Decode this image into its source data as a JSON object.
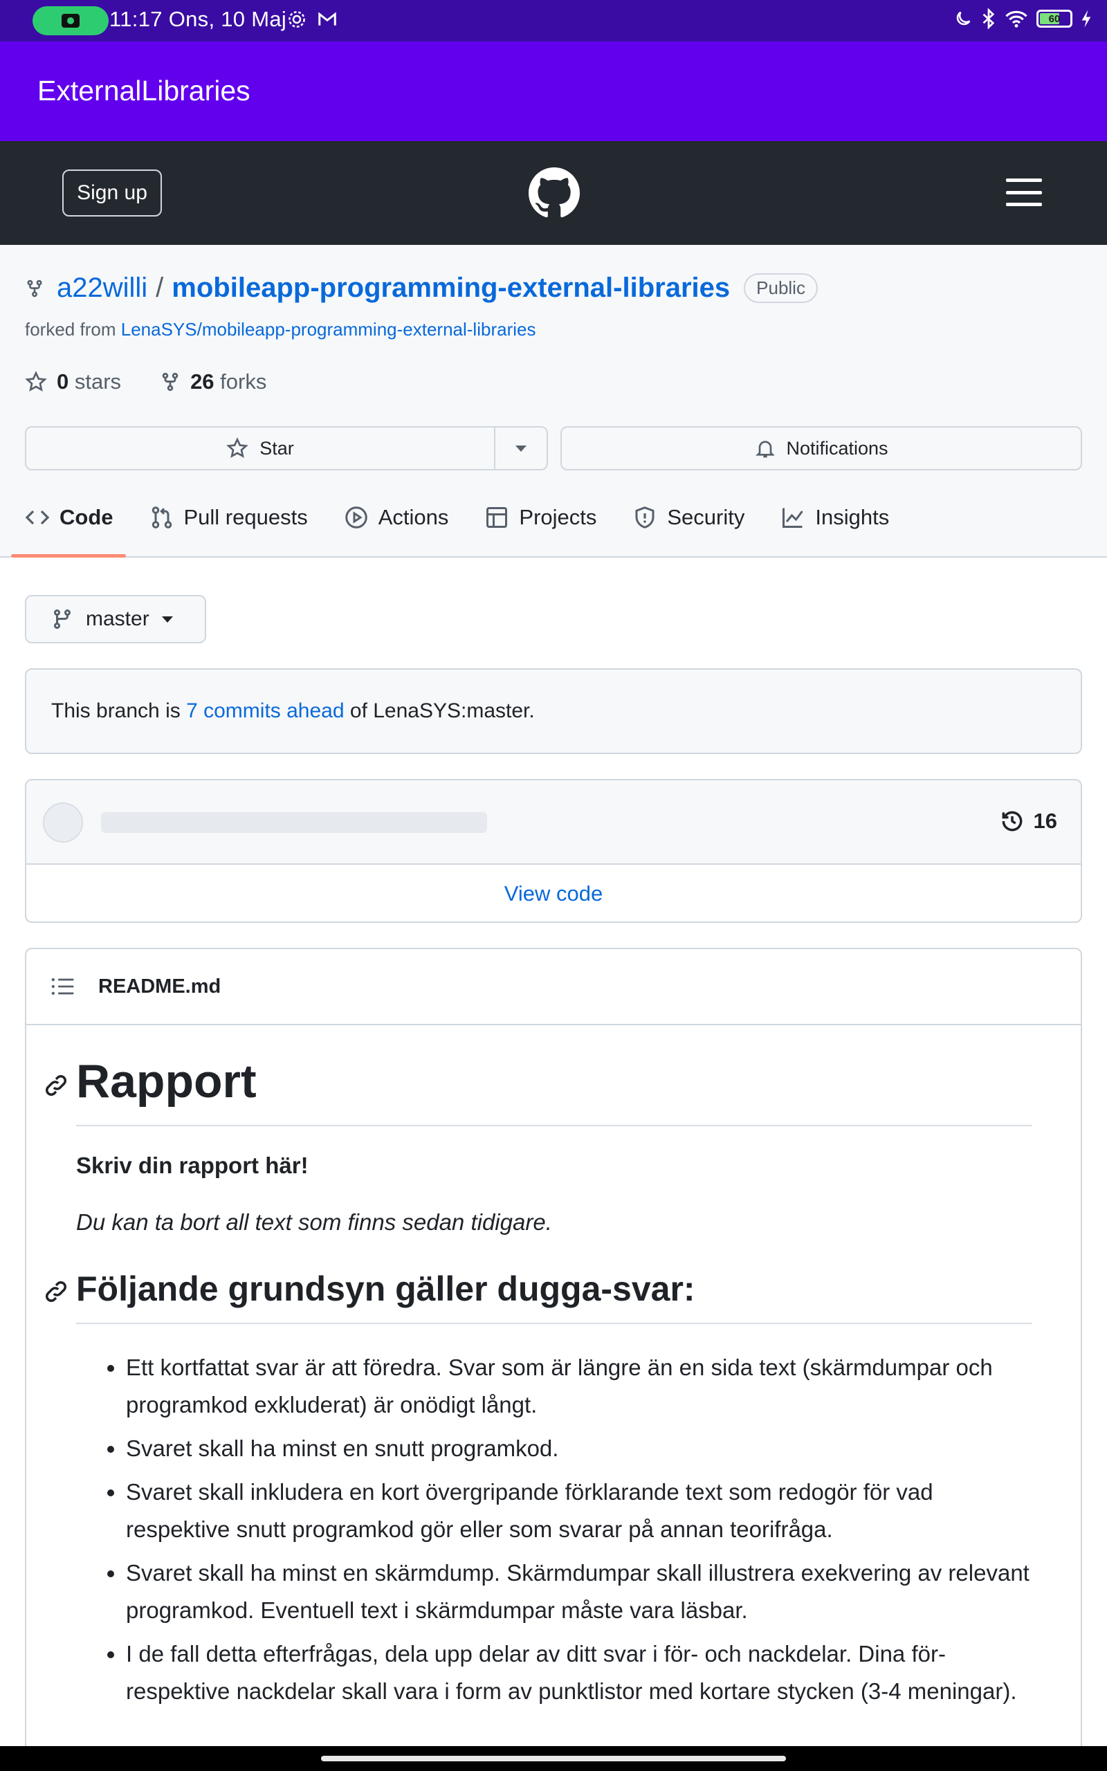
{
  "status_bar": {
    "time_date": "11:17 Ons, 10 Maj",
    "battery_level": "60"
  },
  "app_bar": {
    "title": "ExternalLibraries"
  },
  "github_header": {
    "signup_label": "Sign up"
  },
  "repo": {
    "owner": "a22willi",
    "separator": "/",
    "name": "mobileapp-programming-external-libraries",
    "visibility": "Public",
    "forked_prefix": "forked from",
    "forked_source": "LenaSYS/mobileapp-programming-external-libraries",
    "stars_count": "0",
    "stars_label": "stars",
    "forks_count": "26",
    "forks_label": "forks",
    "star_button": "Star",
    "notifications_button": "Notifications"
  },
  "tabs": [
    {
      "label": "Code",
      "icon": "code-icon",
      "active": true
    },
    {
      "label": "Pull requests",
      "icon": "pull-request-icon"
    },
    {
      "label": "Actions",
      "icon": "play-icon"
    },
    {
      "label": "Projects",
      "icon": "table-icon"
    },
    {
      "label": "Security",
      "icon": "shield-icon"
    },
    {
      "label": "Insights",
      "icon": "graph-icon"
    }
  ],
  "branch": {
    "name": "master",
    "ahead_prefix": "This branch is",
    "ahead_link": "7 commits ahead",
    "ahead_suffix": "of LenaSYS:master."
  },
  "commits": {
    "count": "16",
    "view_code": "View code"
  },
  "readme": {
    "filename": "README.md",
    "h1": "Rapport",
    "p_bold": "Skriv din rapport här!",
    "p_italic": "Du kan ta bort all text som finns sedan tidigare.",
    "h2": "Följande grundsyn gäller dugga-svar:",
    "bullets": [
      "Ett kortfattat svar är att föredra. Svar som är längre än en sida text (skärmdumpar och programkod exkluderat) är onödigt långt.",
      "Svaret skall ha minst en snutt programkod.",
      "Svaret skall inkludera en kort övergripande förklarande text som redogör för vad respektive snutt programkod gör eller som svarar på annan teorifråga.",
      "Svaret skall ha minst en skärmdump. Skärmdumpar skall illustrera exekvering av relevant programkod. Eventuell text i skärmdumpar måste vara läsbar.",
      "I de fall detta efterfrågas, dela upp delar av ditt svar i för- och nackdelar. Dina för- respektive nackdelar skall vara i form av punktlistor med kortare stycken (3-4 meningar)."
    ]
  },
  "colors": {
    "status_bar": "#3a0ca3",
    "app_bar": "#6200ee",
    "github_header": "#24292f",
    "link": "#0969da",
    "tab_underline": "#fd8c73"
  }
}
